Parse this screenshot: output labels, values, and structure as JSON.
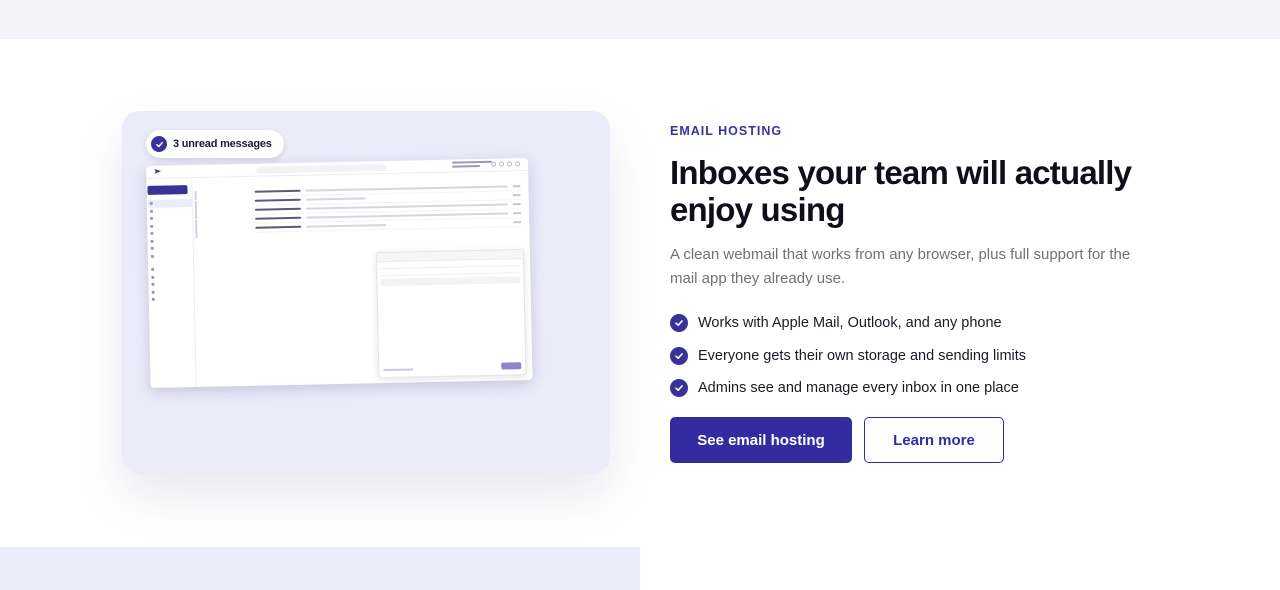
{
  "colors": {
    "accent": "#3a3397",
    "page_top_band": "#f3f3f8",
    "card_background": "#ebebfa"
  },
  "illustration": {
    "badge": {
      "text": "3 unread messages",
      "icon": "check-circle-icon"
    }
  },
  "content": {
    "eyebrow": "EMAIL HOSTING",
    "headline": "Inboxes your team will actually enjoy using",
    "lede": "A clean webmail that works from any browser, plus full support for the mail app they already use.",
    "features": [
      {
        "text": "Works with Apple Mail, Outlook, and any phone",
        "icon": "check-circle-icon"
      },
      {
        "text": "Everyone gets their own storage and sending limits",
        "icon": "check-circle-icon"
      },
      {
        "text": "Admins see and manage every inbox in one place",
        "icon": "check-circle-icon"
      }
    ],
    "primary_button": "See email hosting",
    "secondary_button": "Learn more"
  }
}
